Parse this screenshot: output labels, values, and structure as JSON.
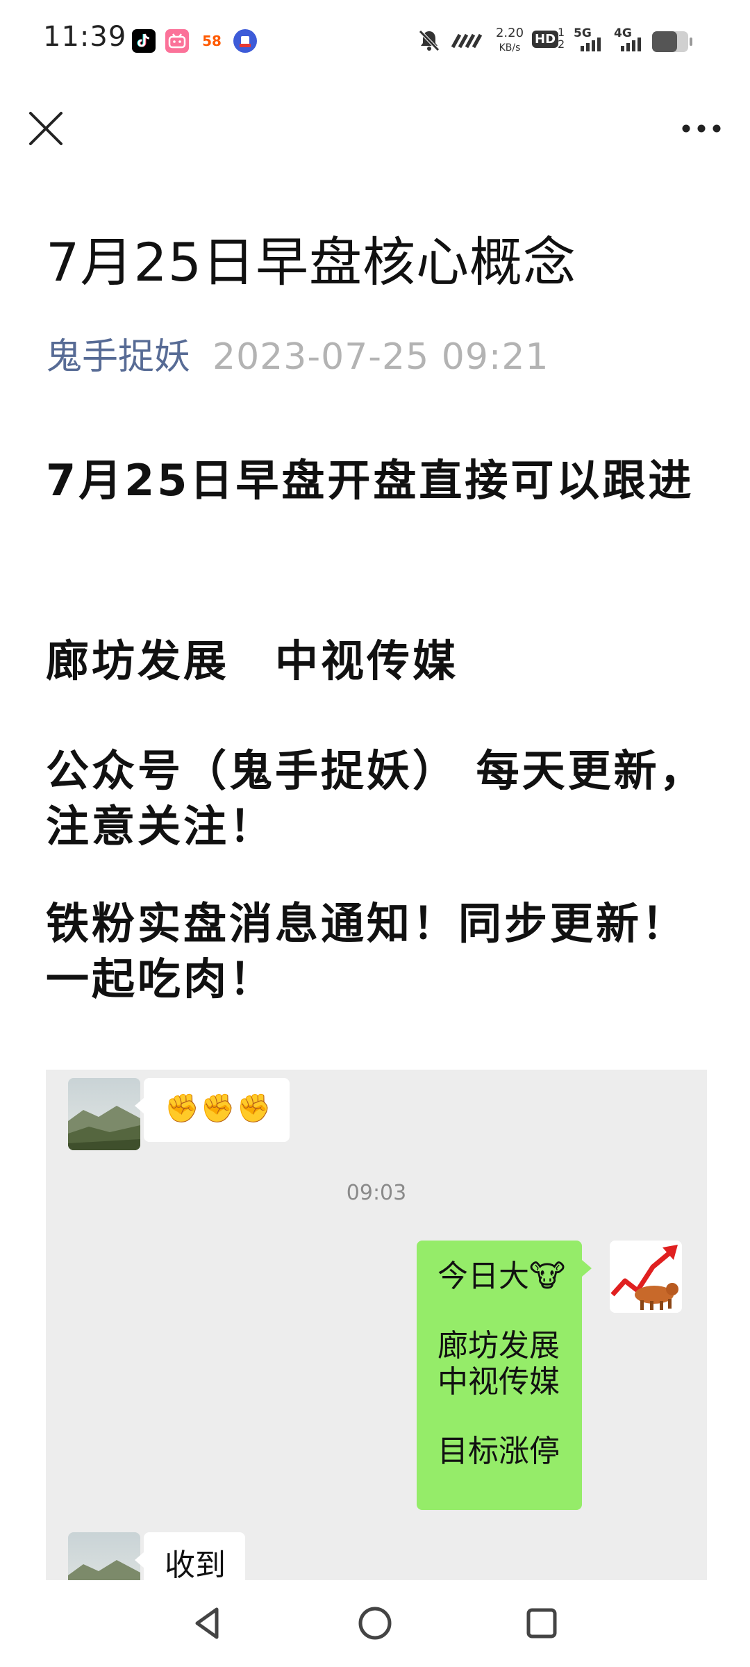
{
  "status_bar": {
    "time": "11:39",
    "app_icons": [
      "tiktok-icon",
      "bilibili-icon",
      "58-app-icon",
      "news-app-icon"
    ],
    "app_icon_58_text": "58",
    "net_speed_value": "2.20",
    "net_speed_unit": "KB/s",
    "hd_label": "HD",
    "sim_label": "1",
    "sim_label_2": "2",
    "signal_5g_label": "5G",
    "signal_4g_label": "4G",
    "battery_level": 0.7
  },
  "nav": {
    "close_icon": "close-icon",
    "more_icon": "more-icon"
  },
  "article": {
    "title": "7月25日早盘核心概念",
    "author": "鬼手捉妖",
    "date": "2023-07-25 09:21",
    "paragraphs": [
      "7月25日早盘开盘直接可以跟进",
      "廊坊发展　中视传媒",
      "公众号（鬼手捉妖） 每天更新，注意关注！",
      "铁粉实盘消息通知！同步更新！一起吃肉！"
    ]
  },
  "chat": {
    "first_message_emoji": "✊✊✊",
    "time": "09:03",
    "reply_lines": [
      "今日大🐮",
      "廊坊发展",
      "中视传媒",
      "目标涨停"
    ],
    "last_message": "收到"
  },
  "colors": {
    "author_link": "#576b95",
    "date_grey": "#b3b3b3",
    "chat_bg": "#ededed",
    "bubble_green": "#95ec69"
  }
}
